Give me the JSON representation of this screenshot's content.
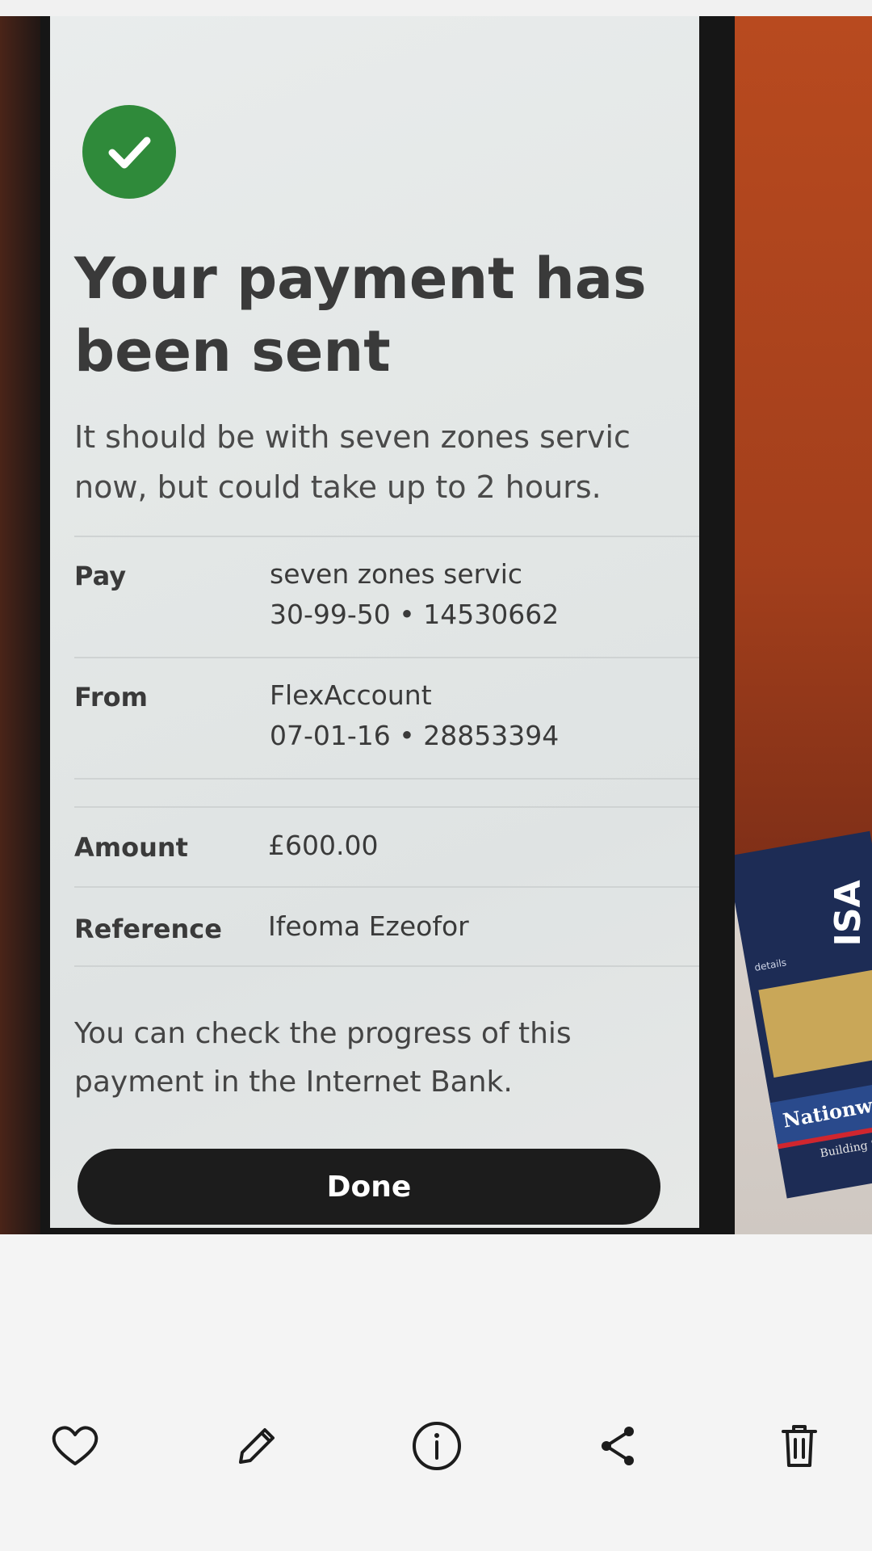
{
  "screen": {
    "title": "Your payment has been sent",
    "subtitle": "It should be with seven zones servic now, but could take up to 2 hours.",
    "details": [
      {
        "label": "Pay",
        "lines": [
          "seven zones servic",
          "30-99-50 • 14530662"
        ]
      },
      {
        "label": "From",
        "lines": [
          "FlexAccount",
          "07-01-16 • 28853394"
        ]
      },
      {
        "label": "Amount",
        "lines": [
          "£600.00"
        ]
      },
      {
        "label": "Reference",
        "lines": [
          "Ifeoma Ezeofor"
        ]
      }
    ],
    "note": "You can check the progress of this payment in the Internet Bank.",
    "done_label": "Done",
    "success_icon": "check-icon",
    "success_color": "#2f8a3a"
  },
  "background_card": {
    "badge": "ISA",
    "small_text": "details",
    "brand": "Nationwide",
    "brand_sub": "Building Society"
  },
  "toolbar": {
    "items": [
      {
        "icon": "heart-icon"
      },
      {
        "icon": "pencil-icon"
      },
      {
        "icon": "info-icon"
      },
      {
        "icon": "share-icon"
      },
      {
        "icon": "trash-icon"
      }
    ]
  }
}
